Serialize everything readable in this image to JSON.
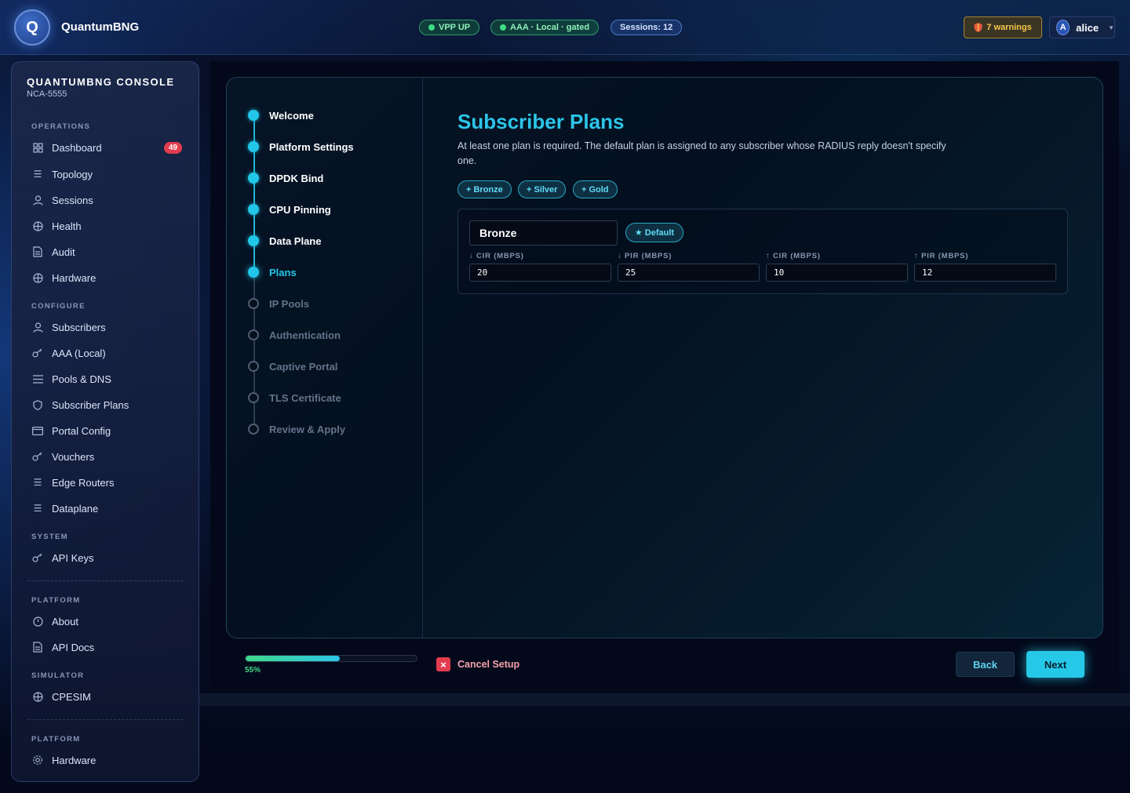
{
  "header": {
    "brand": "QuantumBNG",
    "logo_letter": "Q",
    "status_pills": [
      {
        "label": "VPP UP",
        "color": "#3ddc84"
      },
      {
        "label": "AAA · Local · gated",
        "color": "#3ddc84"
      },
      {
        "label": "Sessions: 12"
      }
    ],
    "warnings_label": "7 warnings",
    "warnings_icon": "shield-icon",
    "user_initial": "A",
    "user_name": "alice"
  },
  "sidebar": {
    "title": "QUANTUMBNG CONSOLE",
    "subtitle": "NCA-5555",
    "sections": [
      {
        "label": "OPERATIONS",
        "items": [
          {
            "label": "Dashboard",
            "icon": "grid-icon",
            "badge": "49"
          },
          {
            "label": "Topology",
            "icon": "sliders-icon"
          },
          {
            "label": "Sessions",
            "icon": "user-icon"
          },
          {
            "label": "Health",
            "icon": "globe-icon"
          },
          {
            "label": "Audit",
            "icon": "document-icon"
          },
          {
            "label": "Hardware",
            "icon": "globe-icon"
          }
        ]
      },
      {
        "label": "CONFIGURE",
        "items": [
          {
            "label": "Subscribers",
            "icon": "user-icon"
          },
          {
            "label": "AAA (Local)",
            "icon": "key-icon"
          },
          {
            "label": "Pools & DNS",
            "icon": "list-icon"
          },
          {
            "label": "Subscriber Plans",
            "icon": "shield-icon"
          },
          {
            "label": "Portal Config",
            "icon": "window-icon"
          },
          {
            "label": "Vouchers",
            "icon": "key-icon"
          },
          {
            "label": "Edge Routers",
            "icon": "sliders-icon"
          },
          {
            "label": "Dataplane",
            "icon": "sliders-icon"
          }
        ]
      },
      {
        "label": "SYSTEM",
        "items": [
          {
            "label": "API Keys",
            "icon": "key-icon"
          }
        ]
      },
      {
        "label": "PLATFORM",
        "items": [
          {
            "label": "About",
            "icon": "info-icon"
          },
          {
            "label": "API Docs",
            "icon": "document-icon"
          }
        ]
      },
      {
        "label": "SIMULATOR",
        "items": [
          {
            "label": "CPESIM",
            "icon": "globe-icon"
          }
        ]
      },
      {
        "label": "PLATFORM",
        "items": [
          {
            "label": "Hardware",
            "icon": "gear-icon"
          }
        ]
      }
    ]
  },
  "wizard": {
    "steps": [
      {
        "label": "Welcome",
        "state": "done"
      },
      {
        "label": "Platform Settings",
        "state": "done"
      },
      {
        "label": "DPDK Bind",
        "state": "done"
      },
      {
        "label": "CPU Pinning",
        "state": "done"
      },
      {
        "label": "Data Plane",
        "state": "done"
      },
      {
        "label": "Plans",
        "state": "current"
      },
      {
        "label": "IP Pools",
        "state": "todo"
      },
      {
        "label": "Authentication",
        "state": "todo"
      },
      {
        "label": "Captive Portal",
        "state": "todo"
      },
      {
        "label": "TLS Certificate",
        "state": "todo"
      },
      {
        "label": "Review & Apply",
        "state": "todo"
      }
    ],
    "title": "Subscriber Plans",
    "description": "At least one plan is required. The default plan is assigned to any subscriber whose RADIUS reply doesn't specify one.",
    "add_buttons": [
      "+ Bronze",
      "+ Silver",
      "+ Gold"
    ],
    "plan": {
      "name": "Bronze",
      "default_label": "Default",
      "fields": [
        {
          "label": "↓ CIR (MBPS)",
          "value": "20"
        },
        {
          "label": "↓ PIR (MBPS)",
          "value": "25"
        },
        {
          "label": "↑ CIR (MBPS)",
          "value": "10"
        },
        {
          "label": "↑ PIR (MBPS)",
          "value": "12"
        }
      ]
    },
    "progress_percent": 55,
    "progress_label": "55%",
    "cancel_label": "Cancel Setup",
    "back_label": "Back",
    "next_label": "Next"
  }
}
